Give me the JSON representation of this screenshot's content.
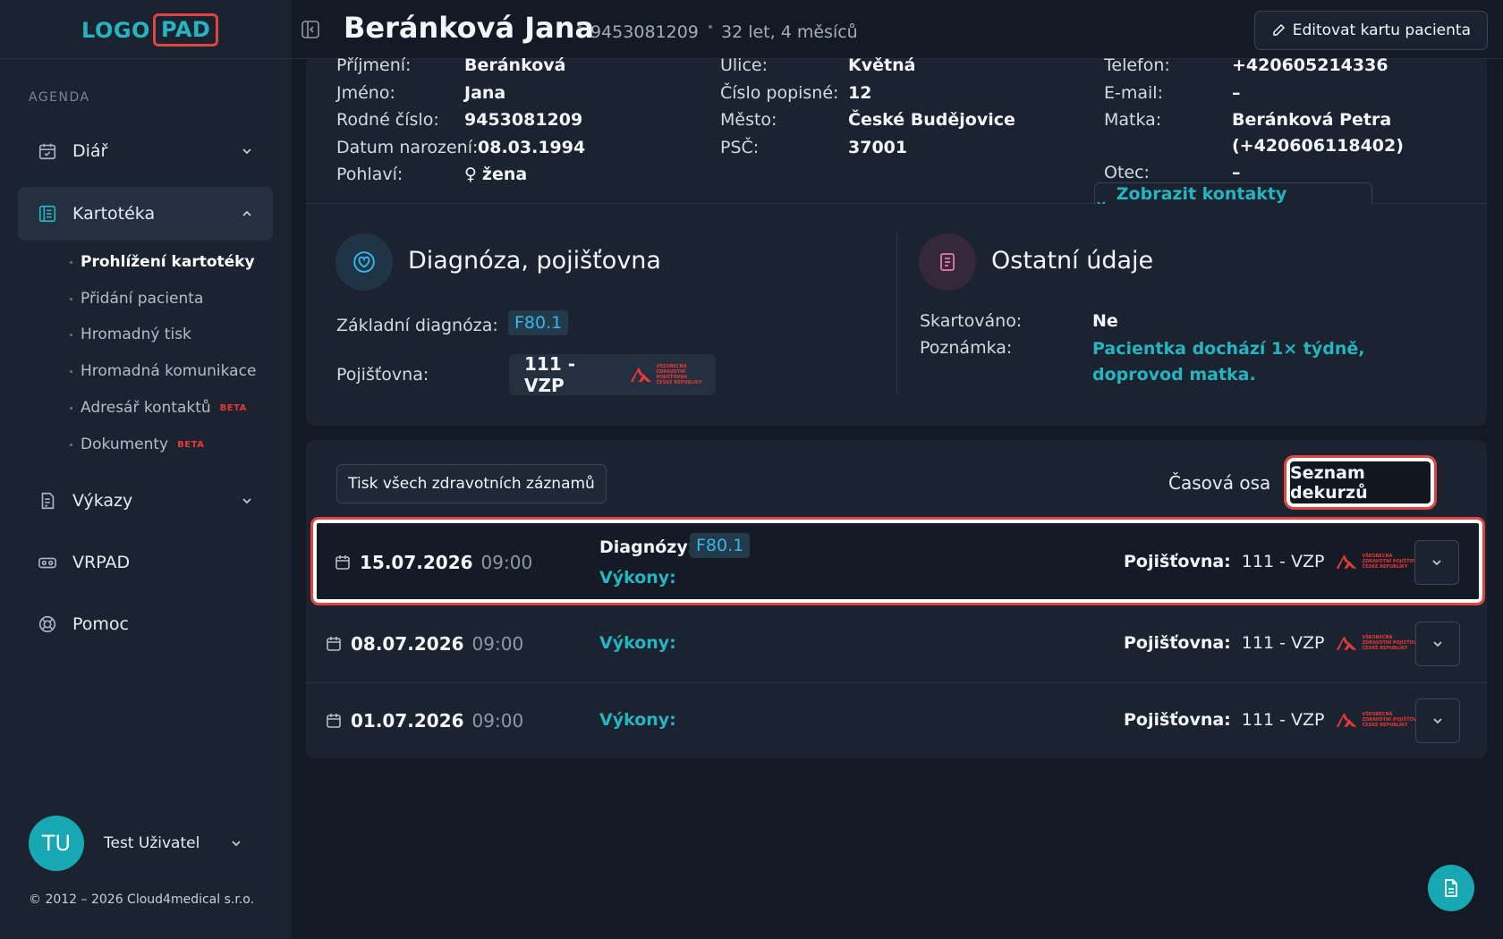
{
  "logo": {
    "part_a": "LOGO",
    "part_b": "PAD"
  },
  "sidebar": {
    "section_label": "AGENDA",
    "items": [
      {
        "label": "Diář"
      },
      {
        "label": "Kartotéka"
      },
      {
        "label": "Výkazy"
      },
      {
        "label": "VRPAD"
      },
      {
        "label": "Pomoc"
      }
    ],
    "sub_items": [
      {
        "label": "Prohlížení kartotéky"
      },
      {
        "label": "Přidání pacienta"
      },
      {
        "label": "Hromadný tisk"
      },
      {
        "label": "Hromadná komunikace"
      },
      {
        "label": "Adresář kontaktů",
        "badge": "BETA"
      },
      {
        "label": "Dokumenty",
        "badge": "BETA"
      }
    ],
    "user": {
      "initials": "TU",
      "name": "Test Uživatel"
    },
    "copyright": "© 2012 – 2026 Cloud4medical s.r.o."
  },
  "header": {
    "patient_name": "Beránková Jana",
    "birth_number": "9453081209",
    "age": "32 let, 4 měsíců",
    "edit_button": "Editovat kartu pacienta"
  },
  "patient": {
    "surname_label": "Příjmení:",
    "surname": "Beránková",
    "firstname_label": "Jméno:",
    "firstname": "Jana",
    "rc_label": "Rodné číslo:",
    "rc": "9453081209",
    "dob_label": "Datum narození:",
    "dob": "08.03.1994",
    "sex_label": "Pohlaví:",
    "sex": "žena",
    "street_label": "Ulice:",
    "street": "Květná",
    "house_label": "Číslo popisné:",
    "house": "12",
    "city_label": "Město:",
    "city": "České Budějovice",
    "zip_label": "PSČ:",
    "zip": "37001",
    "phone_label": "Telefon:",
    "phone": "+420605214336",
    "email_label": "E-mail:",
    "email": "–",
    "mother_label": "Matka:",
    "mother_name": "Beránková Petra",
    "mother_phone": "(+420606118402)",
    "father_label": "Otec:",
    "father": "–",
    "contacts_button": "Zobrazit kontakty pacienta"
  },
  "diagnosis": {
    "title": "Diagnóza, pojišťovna",
    "main_label": "Základní diagnóza:",
    "main_value": "F80.1",
    "insurance_label": "Pojišťovna:",
    "insurance_value": "111 - VZP",
    "insurer_logo_text": [
      "VŠEOBECNÁ",
      "ZDRAVOTNÍ POJIŠŤOVNA",
      "ČESKÉ REPUBLIKY"
    ]
  },
  "other": {
    "title": "Ostatní údaje",
    "shred_label": "Skartováno:",
    "shred_value": "Ne",
    "note_label": "Poznámka:",
    "note_value": "Pacientka dochází 1× týdně, doprovod matka."
  },
  "records": {
    "print_button": "Tisk všech zdravotních záznamů",
    "tab_timeline": "Časová osa",
    "tab_list": "Seznam dekurzů",
    "diag_label": "Diagnózy:",
    "procedures_label": "Výkony:",
    "insurance_label": "Pojišťovna:",
    "rows": [
      {
        "date": "15.07.2026",
        "time": "09:00",
        "diagnosis": "F80.1",
        "insurance": "111 - VZP"
      },
      {
        "date": "08.07.2026",
        "time": "09:00",
        "insurance": "111 - VZP"
      },
      {
        "date": "01.07.2026",
        "time": "09:00",
        "insurance": "111 - VZP"
      }
    ]
  },
  "colors": {
    "accent": "#26b4bf",
    "highlight": "#e0443e",
    "vzp_red": "#e53935"
  }
}
